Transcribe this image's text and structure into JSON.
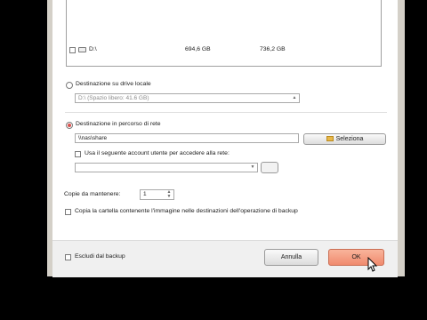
{
  "drives": {
    "row": {
      "name": "D:\\",
      "size1": "694,6 GB",
      "size2": "736,2 GB"
    }
  },
  "local": {
    "radio_label": "Destinazione su drive locale",
    "combo_value": "D:\\  (Spazio libero: 41.6 GB)"
  },
  "network": {
    "radio_label": "Destinazione in percorso di rete",
    "path_value": "\\\\nas\\share",
    "browse_label": "Seleziona",
    "account_label": "Usa il seguente account utente per accedere alla rete:",
    "account_value": ""
  },
  "copies": {
    "label": "Copie da mantenere:",
    "value": "1"
  },
  "copy_folder_label": "Copia la cartella contenente l'immagine nelle destinazioni dell'operazione di backup",
  "footer": {
    "exclude_label": "Escludi dal backup",
    "cancel_label": "Annulla",
    "ok_label": "OK"
  },
  "colors": {
    "ok_accent": "#f08a6e",
    "selected_radio": "#d9534f",
    "folder_icon": "#e8b84a"
  }
}
